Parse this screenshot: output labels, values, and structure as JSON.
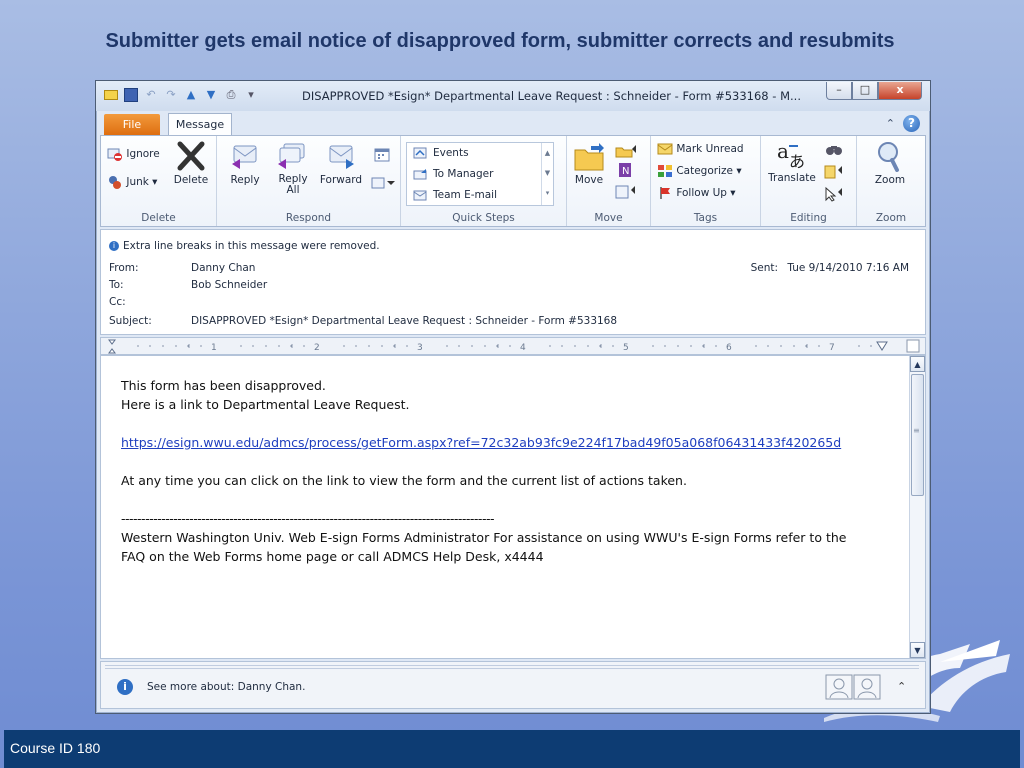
{
  "slide": {
    "title": "Submitter gets email notice of disapproved form, submitter corrects and resubmits",
    "footer": "Course ID 180"
  },
  "window": {
    "title": "DISAPPROVED *Esign*  Departmental Leave Request : Schneider  -  Form #533168  -  M...",
    "controls": {
      "minimize": "–",
      "maximize": "□",
      "close": "x"
    }
  },
  "tabs": {
    "file": "File",
    "message": "Message",
    "collapse": "⌃"
  },
  "ribbon": {
    "delete_group": {
      "label": "Delete",
      "ignore": "Ignore",
      "junk": "Junk ▾",
      "delete": "Delete"
    },
    "respond_group": {
      "label": "Respond",
      "reply": "Reply",
      "reply_all_1": "Reply",
      "reply_all_2": "All",
      "forward": "Forward"
    },
    "quick_steps_group": {
      "label": "Quick Steps",
      "items": [
        "Events",
        "To Manager",
        "Team E-mail"
      ]
    },
    "move_group": {
      "label": "Move",
      "move": "Move"
    },
    "tags_group": {
      "label": "Tags",
      "mark_unread": "Mark Unread",
      "categorize": "Categorize ▾",
      "follow_up": "Follow Up ▾"
    },
    "editing_group": {
      "label": "Editing",
      "translate": "Translate"
    },
    "zoom_group": {
      "label": "Zoom",
      "zoom": "Zoom"
    }
  },
  "header": {
    "info_bar": "Extra line breaks in this message were removed.",
    "from_label": "From:",
    "from": "Danny Chan",
    "to_label": "To:",
    "to": "Bob Schneider",
    "cc_label": "Cc:",
    "cc": "",
    "subject_label": "Subject:",
    "subject": "DISAPPROVED *Esign*  Departmental Leave Request : Schneider  -  Form #533168",
    "sent_label": "Sent:",
    "sent": "Tue 9/14/2010 7:16 AM"
  },
  "ruler": {
    "ticks": [
      "1",
      "2",
      "3",
      "4",
      "5",
      "6",
      "7"
    ]
  },
  "message": {
    "line1": "This form has been disapproved.",
    "line2": "Here is a link to Departmental Leave Request.",
    "link": "https://esign.wwu.edu/admcs/process/getForm.aspx?ref=72c32ab93fc9e224f17bad49f05a068f06431433f420265d",
    "line3": "At any time you can click on the link to view the form and the current list of actions taken.",
    "divider": "---------------------------------------------------------------------------------------------",
    "signature_1": "Western Washington Univ. Web E-sign Forms Administrator For assistance on using WWU's E-sign Forms refer to the",
    "signature_2": "FAQ on the Web Forms home page  or call ADMCS Help Desk, x4444"
  },
  "people_pane": {
    "text": "See more about: Danny Chan."
  },
  "colors": {
    "slide_footer": "#0d3c73",
    "file_tab": "#e8801f",
    "link": "#1f3fbf",
    "title": "#1f3769"
  }
}
